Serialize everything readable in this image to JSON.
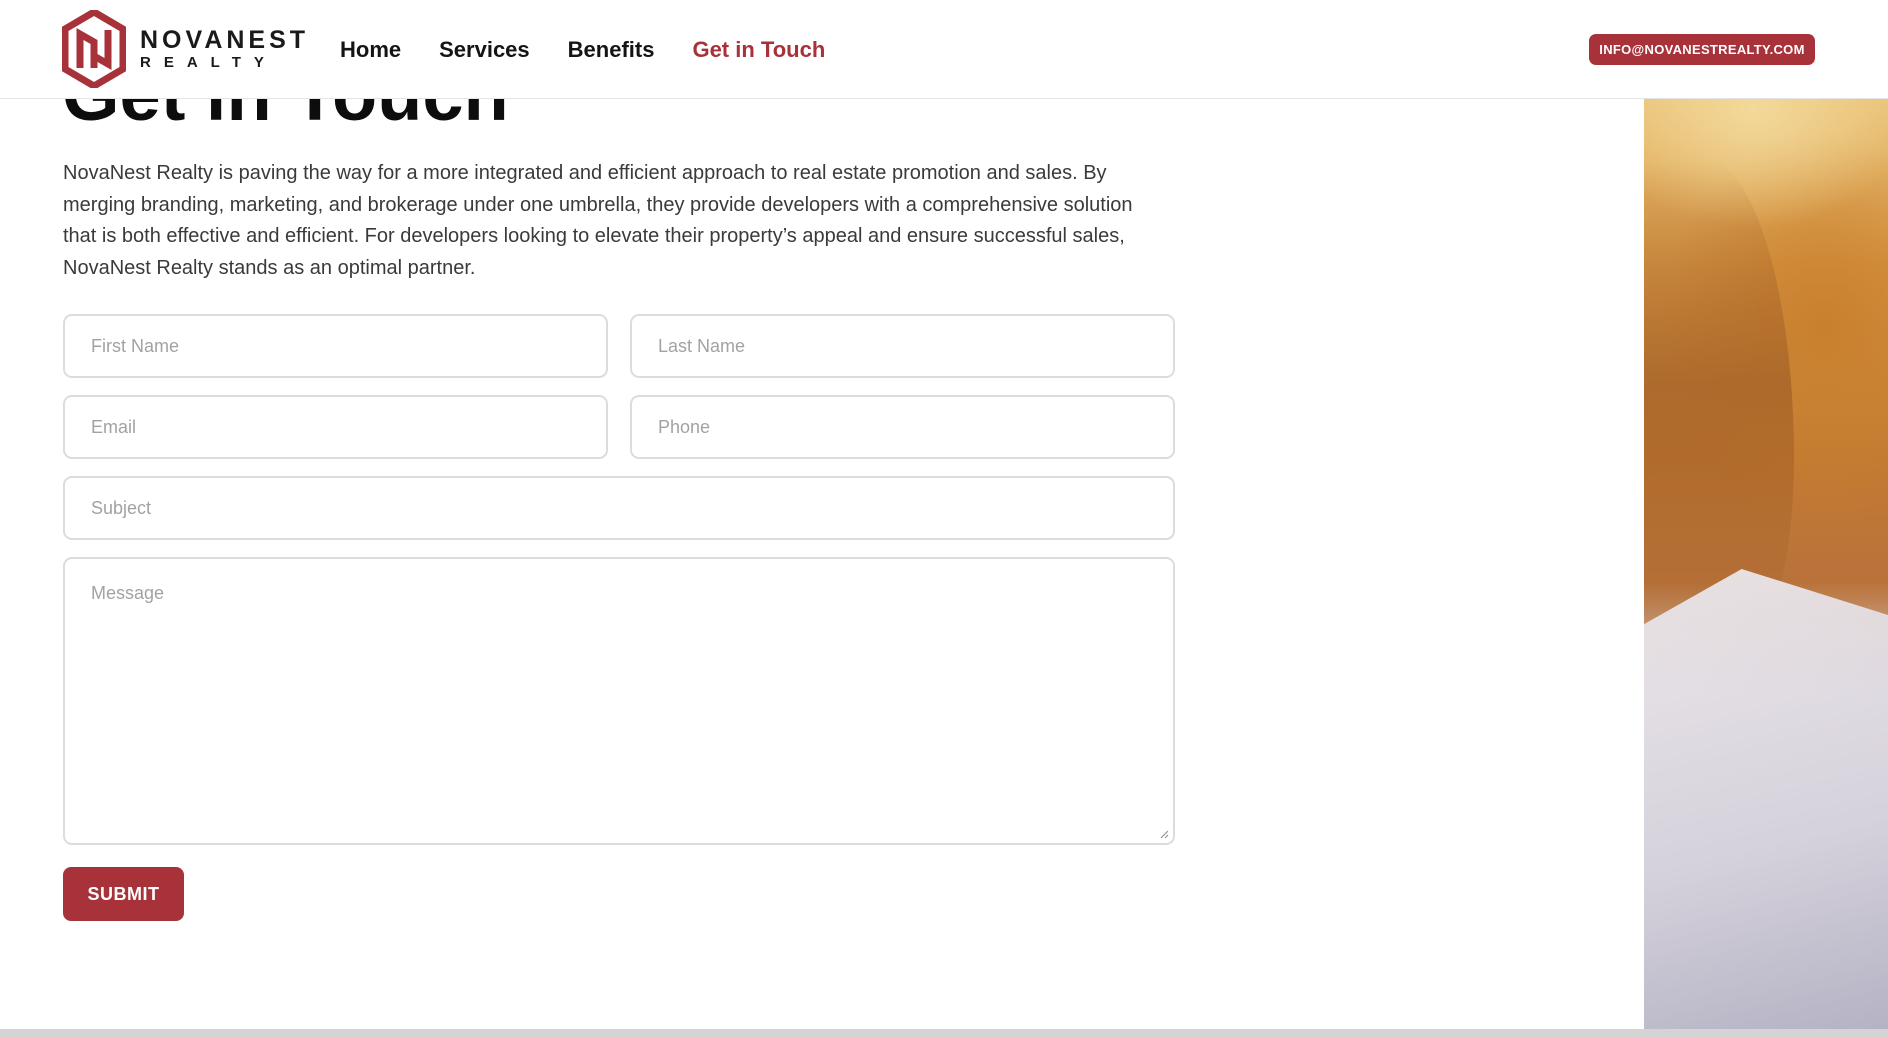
{
  "header": {
    "logo": {
      "name": "NOVANEST",
      "sub": "REALTY"
    },
    "nav": [
      {
        "label": "Home",
        "active": false
      },
      {
        "label": "Services",
        "active": false
      },
      {
        "label": "Benefits",
        "active": false
      },
      {
        "label": "Get in Touch",
        "active": true
      }
    ],
    "email_button": "INFO@NOVANESTREALTY.COM"
  },
  "main": {
    "heading": "Get in Touch",
    "intro": "NovaNest Realty is paving the way for a more integrated and efficient approach to real estate promotion and sales. By merging branding, marketing, and brokerage under one umbrella, they provide developers with a comprehensive solution that is both effective and efficient. For developers looking to elevate their property’s appeal and ensure successful sales, NovaNest Realty stands as an optimal partner.",
    "form": {
      "first_name": {
        "placeholder": "First Name",
        "value": ""
      },
      "last_name": {
        "placeholder": "Last Name",
        "value": ""
      },
      "email": {
        "placeholder": "Email",
        "value": ""
      },
      "phone": {
        "placeholder": "Phone",
        "value": ""
      },
      "subject": {
        "placeholder": "Subject",
        "value": ""
      },
      "message": {
        "placeholder": "Message",
        "value": ""
      },
      "submit_label": "SUBMIT"
    }
  },
  "colors": {
    "brand": "#a8323a",
    "text": "#1a1a1a",
    "placeholder": "#a2a2a2",
    "border": "#dcdcdc"
  },
  "icons": {
    "logo": "novanest-hexagon-logo-icon",
    "resize": "resize-grip-icon"
  }
}
